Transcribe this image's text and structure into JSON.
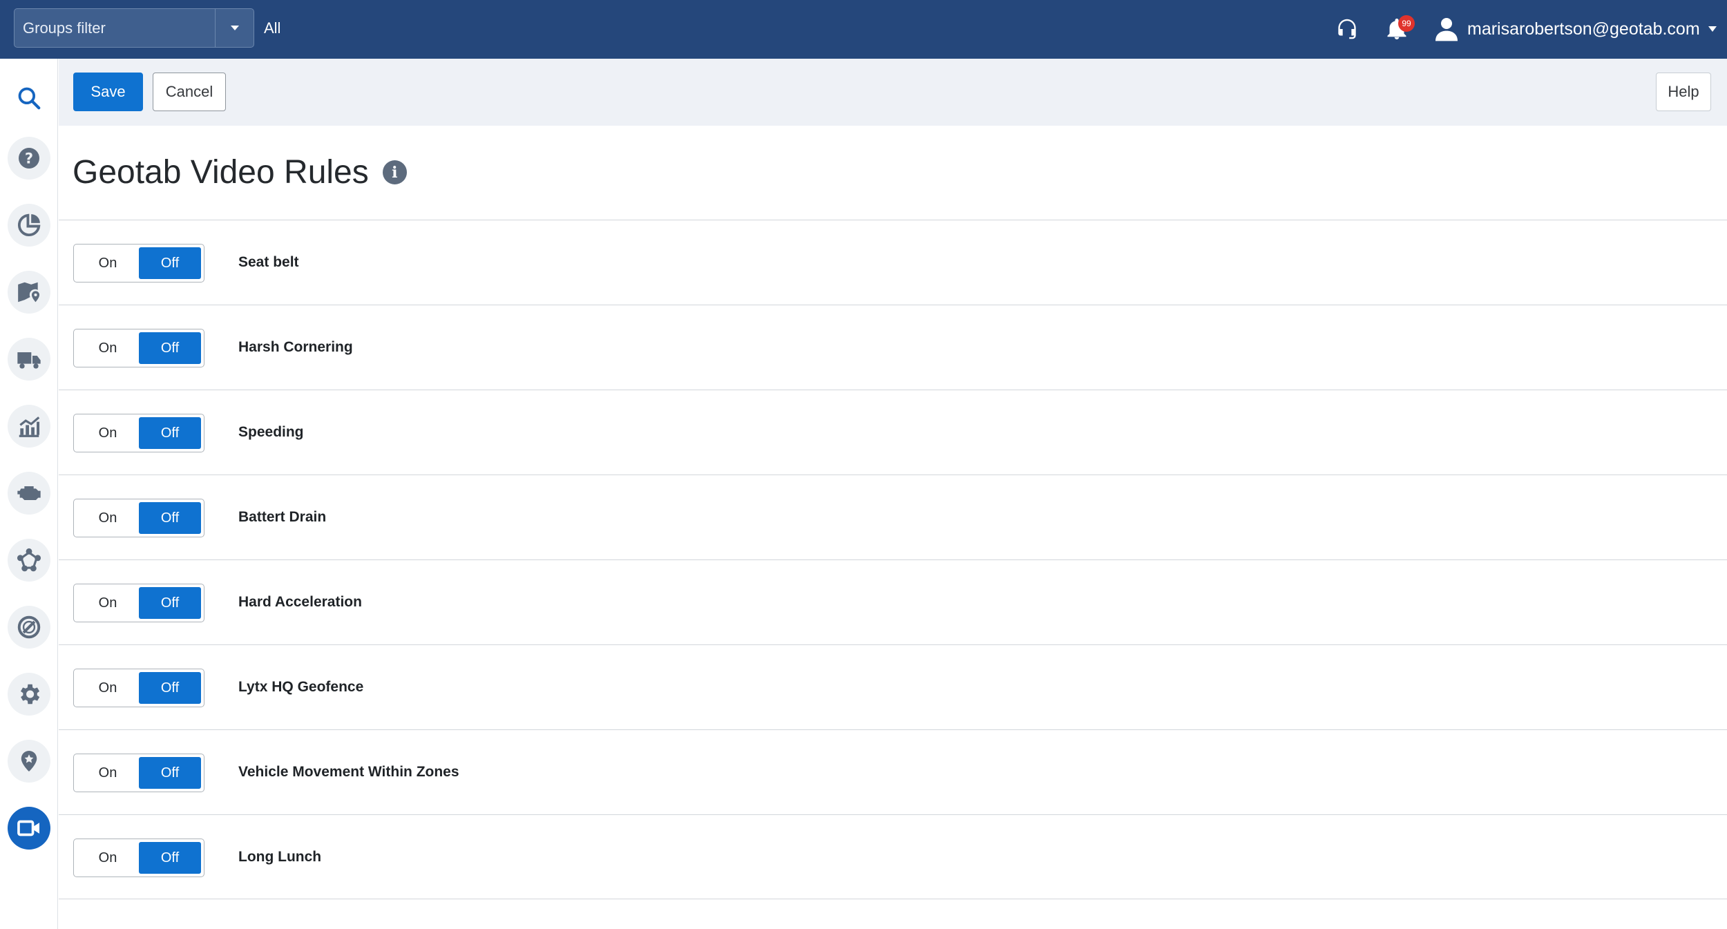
{
  "topbar": {
    "groups_filter_label": "Groups filter",
    "groups_filter_value": "All",
    "notification_count": "99",
    "user_email": "marisarobertson@geotab.com",
    "background_color": "#25477b"
  },
  "sidebar": {
    "items": [
      {
        "icon": "search-icon"
      },
      {
        "icon": "help-icon"
      },
      {
        "icon": "dashboard-pie-icon"
      },
      {
        "icon": "map-icon"
      },
      {
        "icon": "vehicle-truck-icon"
      },
      {
        "icon": "activity-chart-icon"
      },
      {
        "icon": "engine-icon"
      },
      {
        "icon": "rules-network-icon"
      },
      {
        "icon": "exceptions-block-icon"
      },
      {
        "icon": "settings-gear-icon"
      },
      {
        "icon": "marketplace-pin-icon"
      },
      {
        "icon": "video-camera-icon",
        "active": true
      }
    ],
    "active_color": "#1565c0"
  },
  "toolbar": {
    "save_label": "Save",
    "cancel_label": "Cancel",
    "help_label": "Help"
  },
  "page": {
    "title": "Geotab Video Rules"
  },
  "rules": [
    {
      "name": "Seat belt",
      "on_label": "On",
      "off_label": "Off",
      "state": "Off"
    },
    {
      "name": "Harsh Cornering",
      "on_label": "On",
      "off_label": "Off",
      "state": "Off"
    },
    {
      "name": "Speeding",
      "on_label": "On",
      "off_label": "Off",
      "state": "Off"
    },
    {
      "name": "Battert Drain",
      "on_label": "On",
      "off_label": "Off",
      "state": "Off"
    },
    {
      "name": "Hard Acceleration",
      "on_label": "On",
      "off_label": "Off",
      "state": "Off"
    },
    {
      "name": "Lytx HQ Geofence",
      "on_label": "On",
      "off_label": "Off",
      "state": "Off"
    },
    {
      "name": "Vehicle Movement Within Zones",
      "on_label": "On",
      "off_label": "Off",
      "state": "Off"
    },
    {
      "name": "Long Lunch",
      "on_label": "On",
      "off_label": "Off",
      "state": "Off"
    }
  ]
}
